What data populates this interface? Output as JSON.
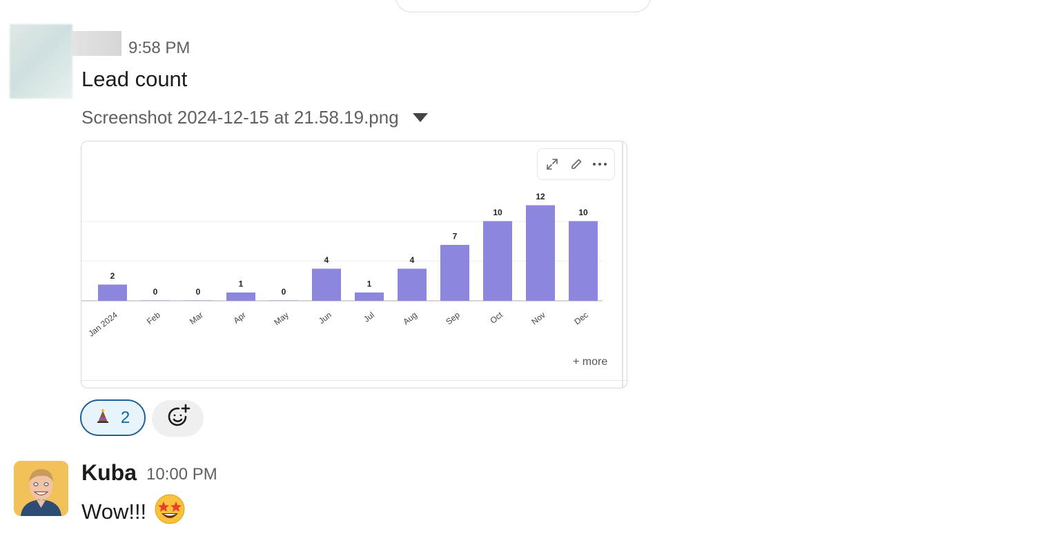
{
  "message1": {
    "time": "9:58 PM",
    "text": "Lead count",
    "file_name": "Screenshot 2024-12-15 at 21.58.19.png"
  },
  "chart_toolbar": {
    "expand_icon": "expand-icon",
    "edit_icon": "pencil-icon",
    "more_icon": "ellipsis-icon"
  },
  "chart_more": "+ more",
  "chart_data": {
    "type": "bar",
    "categories": [
      "Jan 2024",
      "Feb",
      "Mar",
      "Apr",
      "May",
      "Jun",
      "Jul",
      "Aug",
      "Sep",
      "Oct",
      "Nov",
      "Dec"
    ],
    "values": [
      2,
      0,
      0,
      1,
      0,
      4,
      1,
      4,
      7,
      10,
      12,
      10
    ],
    "ylim": [
      0,
      12
    ],
    "bar_color": "#8c86dc",
    "grid": true,
    "legend": "none"
  },
  "reactions": [
    {
      "emoji": "party-hat-emoji",
      "count": "2"
    }
  ],
  "add_reaction_icon": "add-emoji-icon",
  "message2": {
    "author": "Kuba",
    "time": "10:00 PM",
    "text": "Wow!!!",
    "emoji": "star-struck-emoji"
  }
}
